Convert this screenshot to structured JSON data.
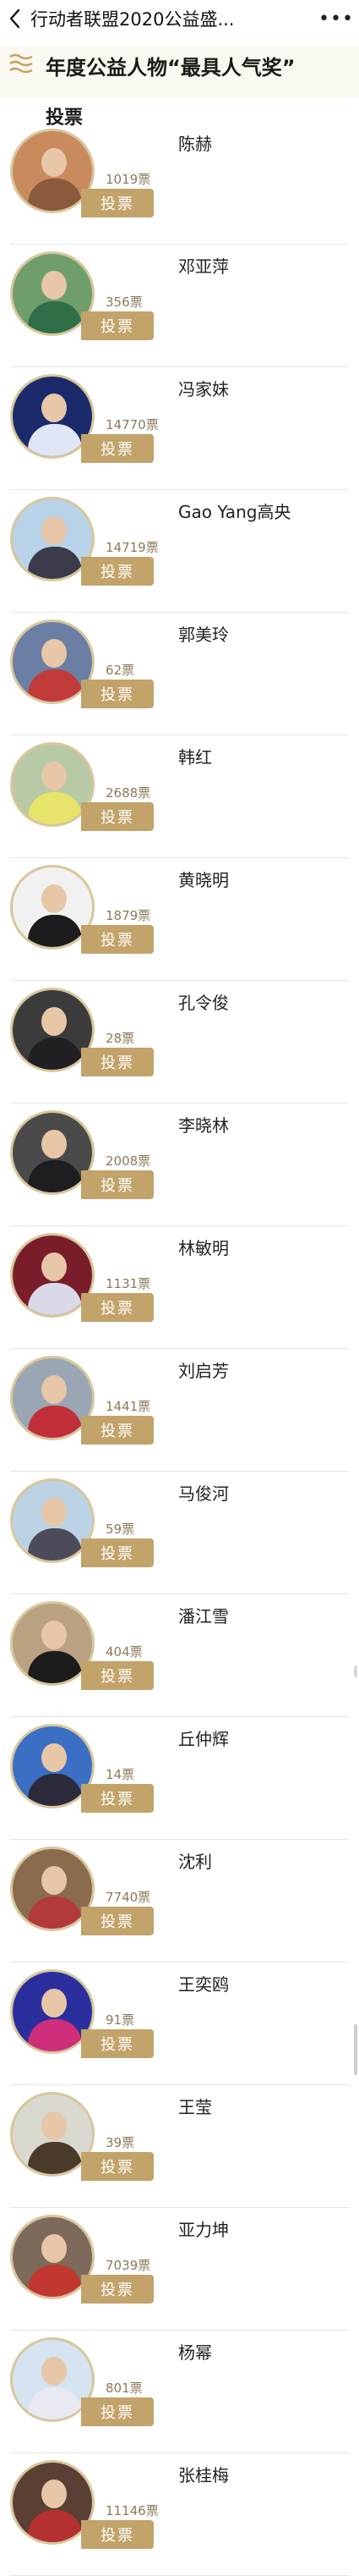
{
  "topbar": {
    "title": "行动者联盟2020公益盛...",
    "back_glyph": "back-icon",
    "more_glyph": "•••"
  },
  "section": {
    "icon": "wave-lines-icon",
    "title": "年度公益人物“最具人气奖”",
    "subtitle": "投票"
  },
  "vote_label": "投票",
  "candidates": [
    {
      "name": "陈赫",
      "votes": "1019票",
      "bg": "#c98b5e",
      "body": "#8a5a3a"
    },
    {
      "name": "邓亚萍",
      "votes": "356票",
      "bg": "#6f9e6b",
      "body": "#2f6e46"
    },
    {
      "name": "冯家妹",
      "votes": "14770票",
      "bg": "#1b2a6b",
      "body": "#dfe6f5"
    },
    {
      "name": "Gao Yang高央",
      "votes": "14719票",
      "bg": "#b9d3e8",
      "body": "#3a3a4a"
    },
    {
      "name": "郭美玲",
      "votes": "62票",
      "bg": "#6b7ea3",
      "body": "#c23b3b"
    },
    {
      "name": "韩红",
      "votes": "2688票",
      "bg": "#b8c9a6",
      "body": "#e8e36b"
    },
    {
      "name": "黄晓明",
      "votes": "1879票",
      "bg": "#f1f1f1",
      "body": "#1c1c1c"
    },
    {
      "name": "孔令俊",
      "votes": "28票",
      "bg": "#3b3b3b",
      "body": "#1f1f24"
    },
    {
      "name": "李晓林",
      "votes": "2008票",
      "bg": "#4a4a4a",
      "body": "#1d1d22"
    },
    {
      "name": "林敏明",
      "votes": "1131票",
      "bg": "#7a1d2a",
      "body": "#d9d9e8"
    },
    {
      "name": "刘启芳",
      "votes": "1441票",
      "bg": "#9aa6b3",
      "body": "#c12f3a"
    },
    {
      "name": "马俊河",
      "votes": "59票",
      "bg": "#bcd3e6",
      "body": "#4b4b5a"
    },
    {
      "name": "潘江雪",
      "votes": "404票",
      "bg": "#b9a282",
      "body": "#1c1c1c"
    },
    {
      "name": "丘仲辉",
      "votes": "14票",
      "bg": "#3a6fc4",
      "body": "#2a2a3a"
    },
    {
      "name": "沈利",
      "votes": "7740票",
      "bg": "#8a6b4d",
      "body": "#b33a3a"
    },
    {
      "name": "王奕鸥",
      "votes": "91票",
      "bg": "#2b2f9e",
      "body": "#cf2f7a"
    },
    {
      "name": "王莹",
      "votes": "39票",
      "bg": "#d9d9cf",
      "body": "#4a3a2a"
    },
    {
      "name": "亚力坤",
      "votes": "7039票",
      "bg": "#7d6a5a",
      "body": "#c2372f"
    },
    {
      "name": "杨幂",
      "votes": "801票",
      "bg": "#d6e3f0",
      "body": "#e9e9f2"
    },
    {
      "name": "张桂梅",
      "votes": "11146票",
      "bg": "#5a3f35",
      "body": "#b53030"
    }
  ]
}
